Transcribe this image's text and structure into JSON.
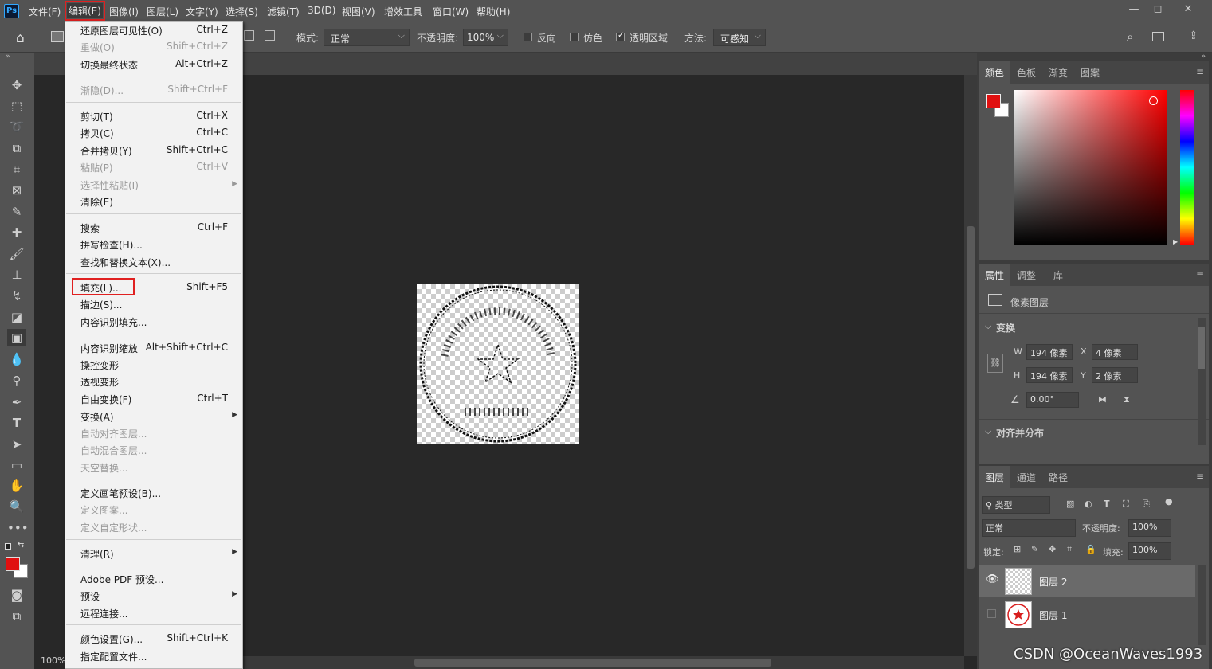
{
  "app": {
    "logo": "Ps"
  },
  "menubar": {
    "items": [
      "文件(F)",
      "编辑(E)",
      "图像(I)",
      "图层(L)",
      "文字(Y)",
      "选择(S)",
      "滤镜(T)",
      "3D(D)",
      "视图(V)",
      "增效工具",
      "窗口(W)",
      "帮助(H)"
    ],
    "active_index": 1
  },
  "window_controls": {
    "minimize": "—",
    "restore": "◻",
    "close": "✕"
  },
  "options": {
    "mode_label": "模式:",
    "mode_value": "正常",
    "opacity_label": "不透明度:",
    "opacity_value": "100%",
    "reverse_label": "反向",
    "dither_label": "仿色",
    "transparency_label": "透明区域",
    "method_label": "方法:",
    "method_value": "可感知"
  },
  "edit_menu": {
    "items": [
      {
        "label": "还原图层可见性(O)",
        "shortcut": "Ctrl+Z",
        "disabled": false
      },
      {
        "label": "重做(O)",
        "shortcut": "Shift+Ctrl+Z",
        "disabled": true
      },
      {
        "label": "切换最终状态",
        "shortcut": "Alt+Ctrl+Z",
        "disabled": false
      },
      {
        "label": "渐隐(D)...",
        "shortcut": "Shift+Ctrl+F",
        "disabled": true
      },
      {
        "label": "剪切(T)",
        "shortcut": "Ctrl+X",
        "disabled": false
      },
      {
        "label": "拷贝(C)",
        "shortcut": "Ctrl+C",
        "disabled": false
      },
      {
        "label": "合并拷贝(Y)",
        "shortcut": "Shift+Ctrl+C",
        "disabled": false
      },
      {
        "label": "粘贴(P)",
        "shortcut": "Ctrl+V",
        "disabled": true
      },
      {
        "label": "选择性粘贴(I)",
        "shortcut": "",
        "disabled": true
      },
      {
        "label": "清除(E)",
        "shortcut": "",
        "disabled": false
      },
      {
        "label": "搜索",
        "shortcut": "Ctrl+F",
        "disabled": false
      },
      {
        "label": "拼写检查(H)...",
        "shortcut": "",
        "disabled": false
      },
      {
        "label": "查找和替换文本(X)...",
        "shortcut": "",
        "disabled": false
      },
      {
        "label": "填充(L)...",
        "shortcut": "Shift+F5",
        "disabled": false
      },
      {
        "label": "描边(S)...",
        "shortcut": "",
        "disabled": false
      },
      {
        "label": "内容识别填充...",
        "shortcut": "",
        "disabled": false
      },
      {
        "label": "内容识别缩放",
        "shortcut": "Alt+Shift+Ctrl+C",
        "disabled": false
      },
      {
        "label": "操控变形",
        "shortcut": "",
        "disabled": false
      },
      {
        "label": "透视变形",
        "shortcut": "",
        "disabled": false
      },
      {
        "label": "自由变换(F)",
        "shortcut": "Ctrl+T",
        "disabled": false
      },
      {
        "label": "变换(A)",
        "shortcut": "",
        "disabled": false
      },
      {
        "label": "自动对齐图层...",
        "shortcut": "",
        "disabled": true
      },
      {
        "label": "自动混合图层...",
        "shortcut": "",
        "disabled": true
      },
      {
        "label": "天空替换...",
        "shortcut": "",
        "disabled": true
      },
      {
        "label": "定义画笔预设(B)...",
        "shortcut": "",
        "disabled": false
      },
      {
        "label": "定义图案...",
        "shortcut": "",
        "disabled": true
      },
      {
        "label": "定义自定形状...",
        "shortcut": "",
        "disabled": true
      },
      {
        "label": "清理(R)",
        "shortcut": "",
        "disabled": false
      },
      {
        "label": "Adobe PDF 预设...",
        "shortcut": "",
        "disabled": false
      },
      {
        "label": "预设",
        "shortcut": "",
        "disabled": false
      },
      {
        "label": "远程连接...",
        "shortcut": "",
        "disabled": false
      },
      {
        "label": "颜色设置(G)...",
        "shortcut": "Shift+Ctrl+K",
        "disabled": false
      },
      {
        "label": "指定配置文件...",
        "shortcut": "",
        "disabled": false
      }
    ]
  },
  "canvas": {
    "zoom": "100%"
  },
  "color_panel": {
    "tabs": [
      "颜色",
      "色板",
      "渐变",
      "图案"
    ],
    "foreground": "#e01010",
    "background": "#ffffff",
    "hue_color": "#ff0000"
  },
  "properties_panel": {
    "tabs": [
      "属性",
      "调整",
      "库"
    ],
    "layer_type": "像素图层",
    "transform_title": "变换",
    "w_label": "W",
    "w_value": "194 像素",
    "h_label": "H",
    "h_value": "194 像素",
    "x_label": "X",
    "x_value": "4 像素",
    "y_label": "Y",
    "y_value": "2 像素",
    "angle_value": "0.00°",
    "align_title": "对齐并分布"
  },
  "layers_panel": {
    "tabs": [
      "图层",
      "通道",
      "路径"
    ],
    "filter_label": "类型",
    "blend_mode": "正常",
    "opacity_label": "不透明度:",
    "opacity_value": "100%",
    "lock_label": "锁定:",
    "fill_label": "填充:",
    "fill_value": "100%",
    "layers": [
      {
        "name": "图层 2",
        "visible": true,
        "selected": true
      },
      {
        "name": "图层 1",
        "visible": false,
        "selected": false
      }
    ]
  },
  "watermark": "CSDN @OceanWaves1993"
}
